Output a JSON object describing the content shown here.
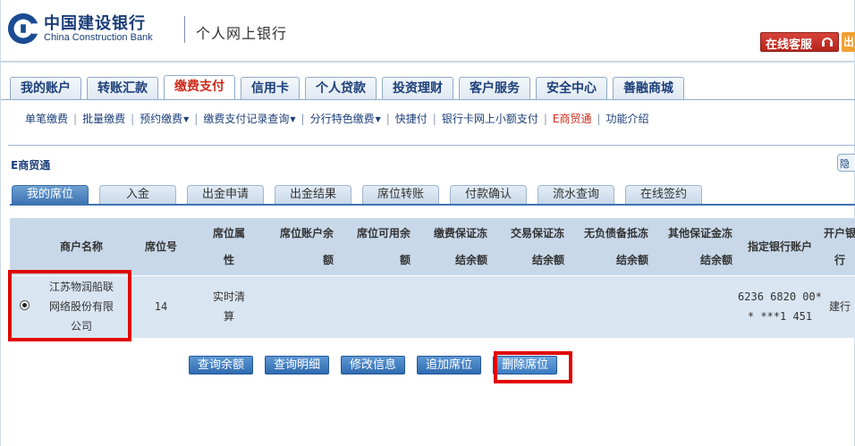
{
  "header": {
    "bank_name_cn": "中国建设银行",
    "bank_name_en": "China Construction Bank",
    "system_name": "个人网上银行",
    "online_service": "在线客服",
    "logout_partial": "出"
  },
  "main_tabs": [
    {
      "label": "我的账户",
      "active": false
    },
    {
      "label": "转账汇款",
      "active": false
    },
    {
      "label": "缴费支付",
      "active": true
    },
    {
      "label": "信用卡",
      "active": false
    },
    {
      "label": "个人贷款",
      "active": false
    },
    {
      "label": "投资理财",
      "active": false
    },
    {
      "label": "客户服务",
      "active": false
    },
    {
      "label": "安全中心",
      "active": false
    },
    {
      "label": "善融商城",
      "active": false
    }
  ],
  "sub_nav": [
    {
      "label": "单笔缴费",
      "dropdown": false,
      "active": false
    },
    {
      "label": "批量缴费",
      "dropdown": false,
      "active": false
    },
    {
      "label": "预约缴费",
      "dropdown": true,
      "active": false
    },
    {
      "label": "缴费支付记录查询",
      "dropdown": true,
      "active": false
    },
    {
      "label": "分行特色缴费",
      "dropdown": true,
      "active": false
    },
    {
      "label": "快捷付",
      "dropdown": false,
      "active": false
    },
    {
      "label": "银行卡网上小额支付",
      "dropdown": false,
      "active": false
    },
    {
      "label": "E商贸通",
      "dropdown": false,
      "active": true
    },
    {
      "label": "功能介绍",
      "dropdown": false,
      "active": false
    }
  ],
  "section": {
    "title": "E商贸通",
    "side_button": "隐"
  },
  "sub_tabs": [
    {
      "label": "我的席位",
      "active": true
    },
    {
      "label": "入金",
      "active": false
    },
    {
      "label": "出金申请",
      "active": false
    },
    {
      "label": "出金结果",
      "active": false
    },
    {
      "label": "席位转账",
      "active": false
    },
    {
      "label": "付款确认",
      "active": false
    },
    {
      "label": "流水查询",
      "active": false
    },
    {
      "label": "在线签约",
      "active": false
    }
  ],
  "table": {
    "headers": {
      "merchant": "商户名称",
      "seat_no": "席位号",
      "seat_attr_1": "席位属",
      "seat_attr_2": "性",
      "seat_bal_1": "席位账户余",
      "seat_bal_2": "额",
      "avail_bal_1": "席位可用余",
      "avail_bal_2": "额",
      "pay_margin_1": "缴费保证冻",
      "pay_margin_2": "结余额",
      "trade_margin_1": "交易保证冻",
      "trade_margin_2": "结余额",
      "no_debt_1": "无负债备抵冻",
      "no_debt_2": "结余额",
      "other_margin_1": "其他保证金冻",
      "other_margin_2": "结余额",
      "bank_account": "指定银行账户",
      "open_bank_1": "开户银",
      "open_bank_2": "行"
    },
    "row": {
      "selected": true,
      "merchant_1": "江苏物润船联",
      "merchant_2": "网络股份有限",
      "merchant_3": "公司",
      "seat_no": "14",
      "seat_attr_1": "实时清",
      "seat_attr_2": "算",
      "seat_bal": "",
      "avail_bal": "",
      "pay_margin": "",
      "trade_margin": "",
      "no_debt": "",
      "other_margin": "",
      "bank_account_1": "6236 6820 00*",
      "bank_account_2": "* ***1 451",
      "open_bank": "建行"
    }
  },
  "actions": {
    "query_balance": "查询余额",
    "query_detail": "查询明细",
    "modify_info": "修改信息",
    "add_seat": "追加席位",
    "delete_seat": "删除席位"
  },
  "colors": {
    "brand_blue": "#1c3f79",
    "active_red": "#cc2a1a",
    "highlight": "#e00000"
  }
}
